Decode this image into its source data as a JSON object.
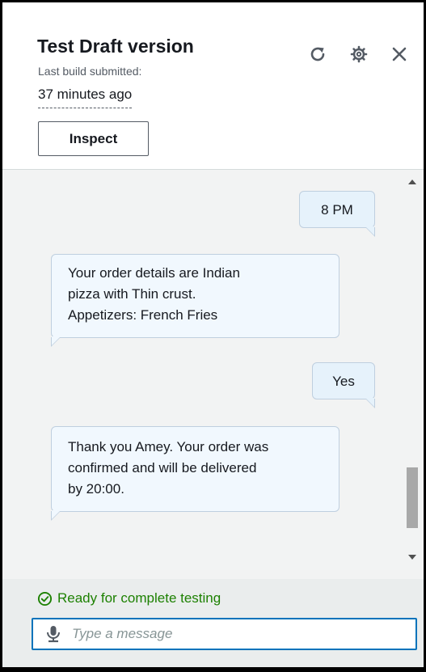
{
  "header": {
    "title": "Test Draft version",
    "subtitle": "Last build submitted:",
    "build_time": "37 minutes ago",
    "inspect_label": "Inspect",
    "icons": [
      "refresh-icon",
      "gear-icon",
      "close-icon"
    ]
  },
  "chat": {
    "messages": [
      {
        "sender": "user",
        "lines": [
          "8 PM"
        ]
      },
      {
        "sender": "bot",
        "lines": [
          "Your order details are Indian",
          "pizza with Thin crust.",
          "Appetizers: French Fries"
        ]
      },
      {
        "sender": "user",
        "lines": [
          "Yes"
        ]
      },
      {
        "sender": "bot",
        "lines": [
          "Thank you Amey. Your order was",
          "confirmed and will be delivered",
          "by 20:00."
        ]
      }
    ]
  },
  "footer": {
    "status": "Ready for complete testing",
    "status_color": "#1d8102",
    "input_placeholder": "Type a message",
    "input_value": ""
  },
  "colors": {
    "accent": "#0073bb",
    "chat_background": "#f2f3f3",
    "bubble_background": "#f1f8fe"
  }
}
